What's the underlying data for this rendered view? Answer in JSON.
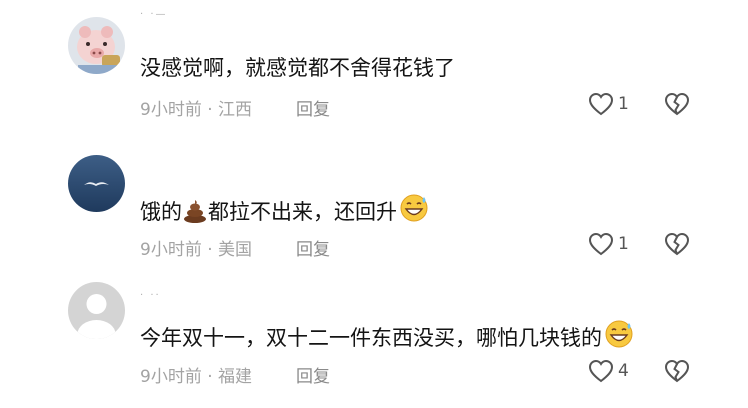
{
  "comments": [
    {
      "username": "· ·— ",
      "text": "没感觉啊，就感觉都不舍得花钱了",
      "time": "9小时前",
      "location": "江西",
      "reply_label": "回复",
      "likes": "1",
      "avatar_icon": "pig-avatar-icon"
    },
    {
      "username": "",
      "text_before_poop": "饿的",
      "text_after_poop": "都拉不出来，还回升",
      "time": "9小时前",
      "location": "美国",
      "reply_label": "回复",
      "likes": "1",
      "avatar_icon": "bird-avatar-icon"
    },
    {
      "username": "· ·· ",
      "text": "今年双十一，双十二一件东西没买，哪怕几块钱的",
      "time": "9小时前",
      "location": "福建",
      "reply_label": "回复",
      "likes": "4",
      "avatar_icon": "default-avatar-icon"
    }
  ],
  "meta_separator": " · ",
  "colors": {
    "background": "#ffffff",
    "text": "#141414",
    "meta": "#a3a3a3"
  }
}
